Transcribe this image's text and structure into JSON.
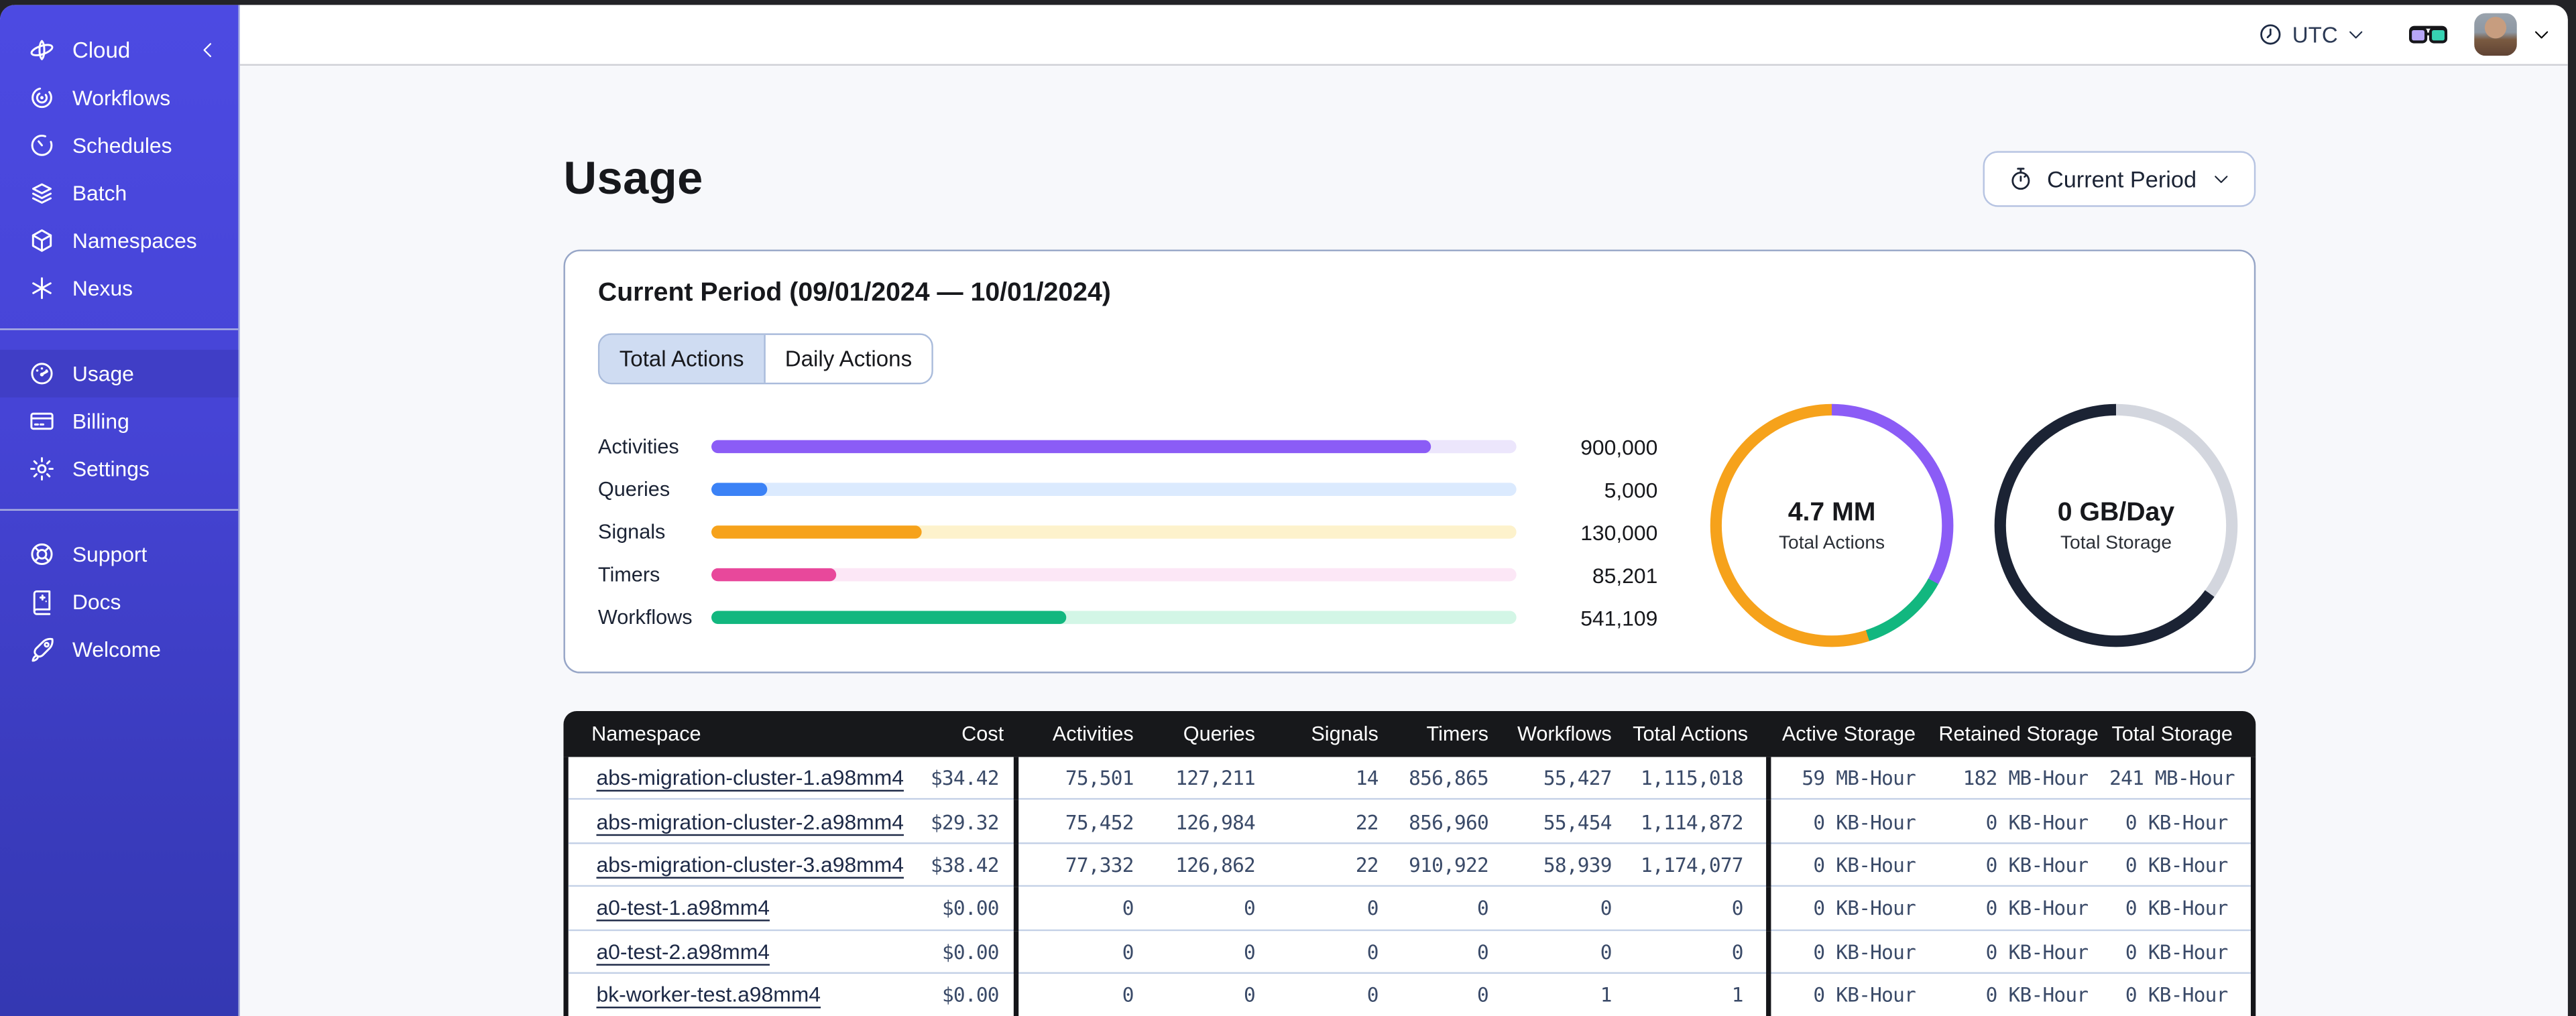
{
  "sidebar": {
    "header": {
      "label": "Cloud",
      "icon": "cloud-logo-icon",
      "collapse_icon": "chevron-left-icon"
    },
    "sections": [
      {
        "items": [
          {
            "label": "Workflows",
            "icon": "workflows-icon",
            "selected": false
          },
          {
            "label": "Schedules",
            "icon": "schedules-icon",
            "selected": false
          },
          {
            "label": "Batch",
            "icon": "batch-icon",
            "selected": false
          },
          {
            "label": "Namespaces",
            "icon": "namespaces-icon",
            "selected": false
          },
          {
            "label": "Nexus",
            "icon": "nexus-icon",
            "selected": false
          }
        ]
      },
      {
        "items": [
          {
            "label": "Usage",
            "icon": "usage-icon",
            "selected": true
          },
          {
            "label": "Billing",
            "icon": "billing-icon",
            "selected": false
          },
          {
            "label": "Settings",
            "icon": "settings-icon",
            "selected": false
          }
        ]
      },
      {
        "items": [
          {
            "label": "Support",
            "icon": "support-icon",
            "selected": false
          },
          {
            "label": "Docs",
            "icon": "docs-icon",
            "selected": false
          },
          {
            "label": "Welcome",
            "icon": "welcome-icon",
            "selected": false
          }
        ]
      }
    ]
  },
  "topbar": {
    "timezone": {
      "label": "UTC",
      "icon": "clock-icon",
      "chevron": "chevron-down-icon"
    },
    "glasses_icon": "3d-glasses-icon",
    "avatar": "user-avatar",
    "avatar_chevron": "chevron-down-icon"
  },
  "main": {
    "title": "Usage",
    "period_button": {
      "label": "Current Period",
      "icon": "stopwatch-icon",
      "chevron": "chevron-down-icon"
    },
    "card": {
      "title": "Current Period (09/01/2024 — 10/01/2024)",
      "tabs": [
        {
          "label": "Total Actions",
          "selected": true
        },
        {
          "label": "Daily Actions",
          "selected": false
        }
      ]
    }
  },
  "chart_data": [
    {
      "type": "bar",
      "orientation": "horizontal",
      "categories": [
        "Activities",
        "Queries",
        "Signals",
        "Timers",
        "Workflows"
      ],
      "values": [
        900000,
        5000,
        130000,
        85201,
        541109
      ],
      "value_labels": [
        "900,000",
        "5,000",
        "130,000",
        "85,201",
        "541,109"
      ],
      "fill_pct": [
        89.4,
        7,
        26.1,
        15.5,
        44.1
      ],
      "colors": [
        "#8b5cf6",
        "#3b82f6",
        "#f6a21b",
        "#e8489b",
        "#12b77f"
      ],
      "track_colors": [
        "#ece6fc",
        "#dbeafe",
        "#fdf2cc",
        "#fce7f6",
        "#d3f6e6"
      ],
      "grid": false,
      "legend": "none"
    },
    {
      "type": "donut",
      "center_value": "4.7 MM",
      "center_label": "Total Actions",
      "segments": [
        {
          "name": "activities",
          "pct": 33,
          "color": "#8b5cf6"
        },
        {
          "name": "workflows",
          "pct": 12,
          "color": "#12b77f"
        },
        {
          "name": "other-actions",
          "pct": 55,
          "color": "#f6a21b"
        }
      ]
    },
    {
      "type": "donut",
      "center_value": "0 GB/Day",
      "center_label": "Total Storage",
      "segments": [
        {
          "name": "remaining",
          "pct": 35,
          "color": "#d3d6de"
        },
        {
          "name": "used",
          "pct": 65,
          "color": "#1b2334"
        }
      ]
    }
  ],
  "table": {
    "columns": [
      "Namespace",
      "Cost",
      "Activities",
      "Queries",
      "Signals",
      "Timers",
      "Workflows",
      "Total Actions",
      "Active Storage",
      "Retained Storage",
      "Total Storage"
    ],
    "rows": [
      {
        "namespace": "abs-migration-cluster-1.a98mm4",
        "cells": [
          "$34.42",
          "75,501",
          "127,211",
          "14",
          "856,865",
          "55,427",
          "1,115,018",
          "59 MB-Hour",
          "182 MB-Hour",
          "241 MB-Hour"
        ]
      },
      {
        "namespace": "abs-migration-cluster-2.a98mm4",
        "cells": [
          "$29.32",
          "75,452",
          "126,984",
          "22",
          "856,960",
          "55,454",
          "1,114,872",
          "0 KB-Hour",
          "0 KB-Hour",
          "0 KB-Hour"
        ]
      },
      {
        "namespace": "abs-migration-cluster-3.a98mm4",
        "cells": [
          "$38.42",
          "77,332",
          "126,862",
          "22",
          "910,922",
          "58,939",
          "1,174,077",
          "0 KB-Hour",
          "0 KB-Hour",
          "0 KB-Hour"
        ]
      },
      {
        "namespace": "a0-test-1.a98mm4",
        "cells": [
          "$0.00",
          "0",
          "0",
          "0",
          "0",
          "0",
          "0",
          "0 KB-Hour",
          "0 KB-Hour",
          "0 KB-Hour"
        ]
      },
      {
        "namespace": "a0-test-2.a98mm4",
        "cells": [
          "$0.00",
          "0",
          "0",
          "0",
          "0",
          "0",
          "0",
          "0 KB-Hour",
          "0 KB-Hour",
          "0 KB-Hour"
        ]
      },
      {
        "namespace": "bk-worker-test.a98mm4",
        "cells": [
          "$0.00",
          "0",
          "0",
          "0",
          "0",
          "1",
          "1",
          "0 KB-Hour",
          "0 KB-Hour",
          "0 KB-Hour"
        ]
      }
    ]
  }
}
